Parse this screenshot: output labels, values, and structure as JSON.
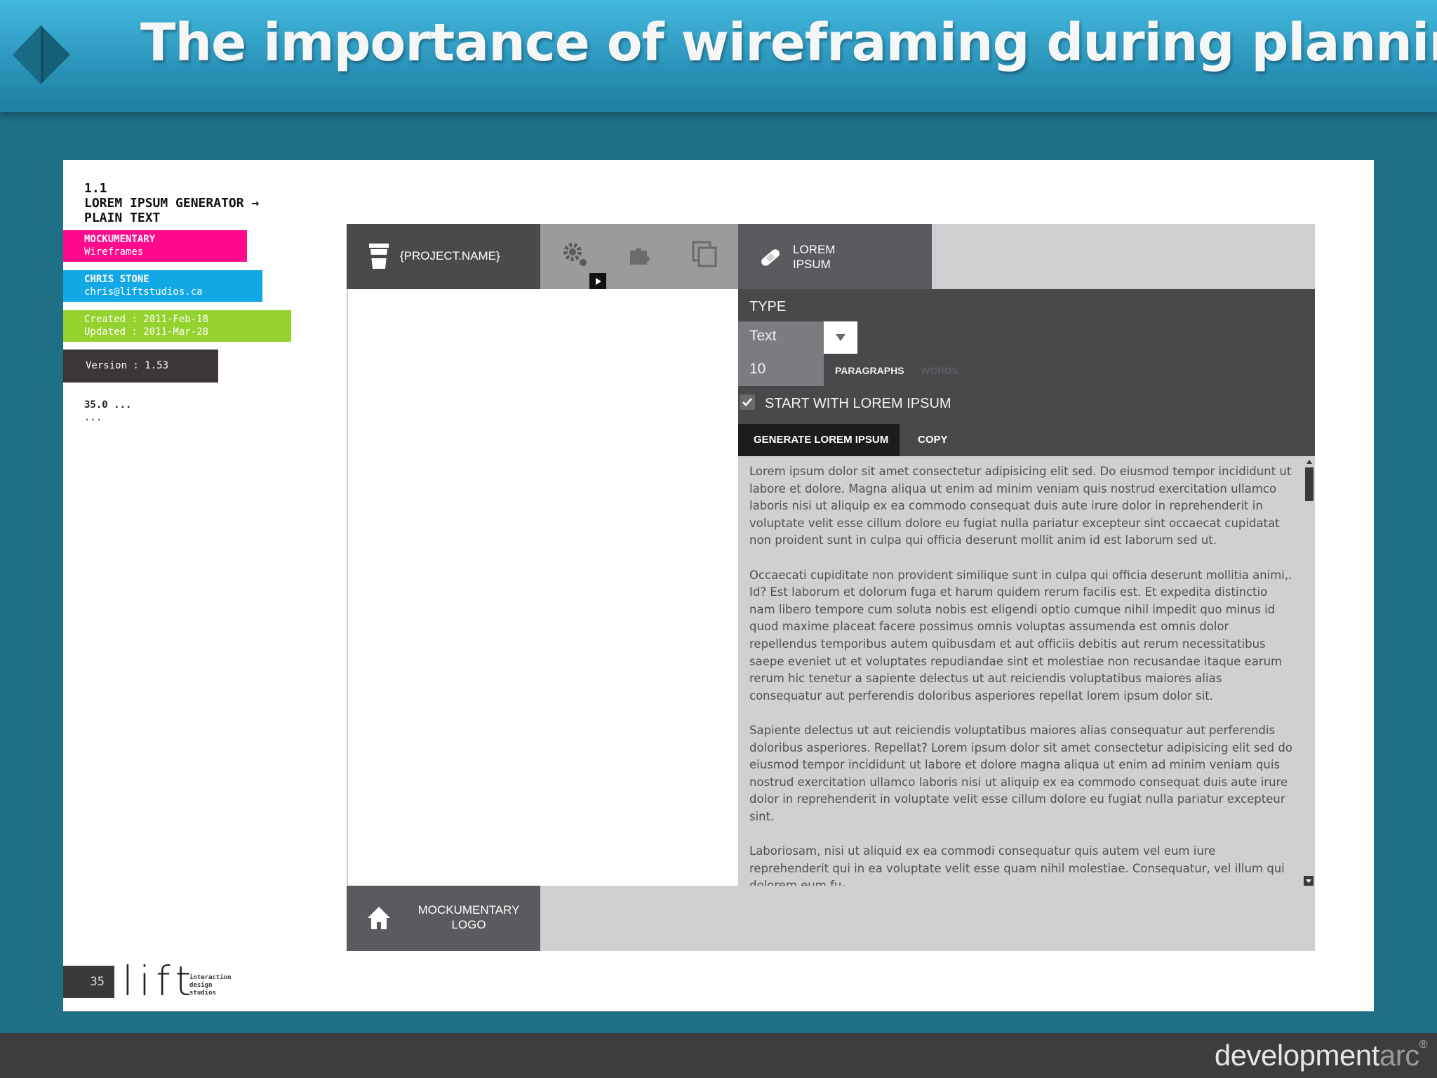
{
  "slide": {
    "title": "The importance of wireframing during planning",
    "brand_main": "development",
    "brand_accent": "arc",
    "brand_mark": "®"
  },
  "doc": {
    "section_number": "1.1",
    "section_title_1": "LOREM IPSUM GENERATOR →",
    "section_title_2": "PLAIN TEXT",
    "project": {
      "name": "MOCKUMENTARY",
      "subtitle": "Wireframes"
    },
    "author": {
      "name": "CHRIS STONE",
      "email": "chris@liftstudios.ca"
    },
    "dates": {
      "created": "Created : 2011-Feb-18",
      "updated": "Updated : 2011-Mar-28"
    },
    "version": "Version : 1.53",
    "screen_id": "35.0 ...",
    "screen_sub": "...",
    "page_number": "35",
    "studio_logo": "lift",
    "studio_tagline": [
      "interaction",
      "design",
      "studios"
    ]
  },
  "app": {
    "project_name": "{PROJECT.NAME}",
    "active_tab_line1": "LOREM",
    "active_tab_line2": "IPSUM",
    "type_label": "TYPE",
    "type_value": "Text",
    "count_value": "10",
    "unit_selected": "PARAGRAPHS",
    "unit_other": "WORDS",
    "start_with_label": "START WITH LOREM IPSUM",
    "start_with_checked": true,
    "generate_label": "GENERATE LOREM IPSUM",
    "copy_label": "COPY",
    "output_paragraphs": [
      "Lorem ipsum dolor sit amet consectetur adipisicing elit sed. Do eiusmod tempor incididunt ut labore et dolore. Magna aliqua ut enim ad minim veniam quis nostrud exercitation ullamco laboris nisi ut aliquip ex ea commodo consequat duis aute irure dolor in reprehenderit in voluptate velit esse cillum dolore eu fugiat nulla pariatur excepteur sint occaecat cupidatat non proident sunt in culpa qui officia deserunt mollit anim id est laborum sed ut.",
      "Occaecati cupiditate non provident similique sunt in culpa qui officia deserunt mollitia animi,. Id? Est laborum et dolorum fuga et harum quidem rerum facilis est. Et expedita distinctio nam libero tempore cum soluta nobis est eligendi optio cumque nihil impedit quo minus id quod maxime placeat facere possimus omnis voluptas assumenda est omnis dolor repellendus temporibus autem quibusdam et aut officiis debitis aut rerum necessitatibus saepe eveniet ut et voluptates repudiandae sint et molestiae non recusandae itaque earum rerum hic tenetur a sapiente delectus ut aut reiciendis voluptatibus maiores alias consequatur aut perferendis doloribus asperiores repellat lorem ipsum dolor sit.",
      "Sapiente delectus ut aut reiciendis voluptatibus maiores alias consequatur aut perferendis doloribus asperiores. Repellat? Lorem ipsum dolor sit amet consectetur adipisicing elit sed do eiusmod tempor incididunt ut labore et dolore magna aliqua ut enim ad minim veniam quis nostrud exercitation ullamco laboris nisi ut aliquip ex ea commodo consequat duis aute irure dolor in reprehenderit in voluptate velit esse cillum dolore eu fugiat nulla pariatur excepteur sint.",
      "Laboriosam, nisi ut aliquid ex ea commodi consequatur quis autem vel eum iure reprehenderit qui in ea voluptate velit esse quam nihil molestiae. Consequatur, vel illum qui dolorem eum fu-"
    ],
    "footer_logo_line1": "MOCKUMENTARY",
    "footer_logo_line2": "LOGO"
  },
  "colors": {
    "header": "#2a93b9",
    "page_bg": "#1f6f86",
    "tag_pink": "#ff0a8c",
    "tag_blue": "#12a8e6",
    "tag_green": "#94d22d",
    "tag_dark": "#3d3636",
    "app_dark": "#49484b",
    "app_light": "#d0d0d2"
  },
  "icons": [
    "arc-logo-icon",
    "coffee-cup-icon",
    "gear-icon",
    "puzzle-icon",
    "copy-pages-icon",
    "bandage-icon",
    "play-icon",
    "chevron-down-icon",
    "checkmark-icon",
    "scroll-up-icon",
    "scroll-down-icon",
    "home-icon"
  ]
}
